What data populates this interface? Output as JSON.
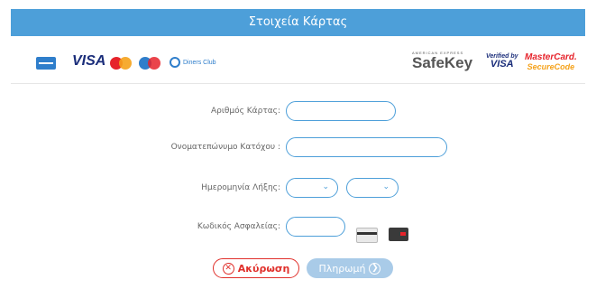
{
  "header": {
    "title": "Στοιχεία Κάρτας"
  },
  "logos": {
    "visa": "VISA",
    "diners": "Diners Club",
    "safekey_small": "AMERICAN EXPRESS",
    "safekey": "SafeKey",
    "vbv_line1": "Verified by",
    "vbv_line2": "VISA",
    "mcsc_line1": "MasterCard.",
    "mcsc_line2": "SecureCode"
  },
  "form": {
    "card_number_label": "Αριθμός Κάρτας:",
    "card_number_value": "",
    "holder_label": "Ονοματεπώνυμο Κατόχου :",
    "holder_value": "",
    "expiry_label": "Ημερομηνία Λήξης:",
    "expiry_month": "",
    "expiry_year": "",
    "cvv_label": "Κωδικός Ασφαλείας:",
    "cvv_value": ""
  },
  "buttons": {
    "cancel": "Ακύρωση",
    "pay": "Πληρωμή"
  },
  "colors": {
    "accent": "#4d9fd9",
    "cancel": "#e0302b",
    "pay_disabled": "#a9cbe8"
  }
}
